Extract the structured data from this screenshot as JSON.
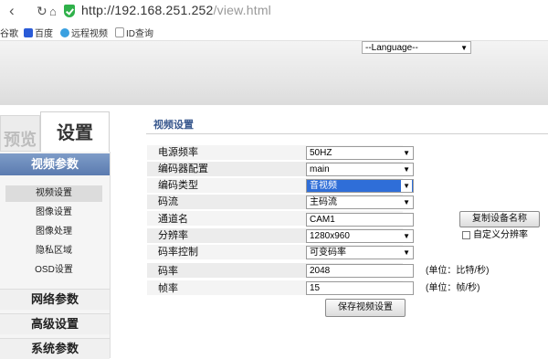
{
  "browser": {
    "url_host": "http://192.168.251.252",
    "url_path": "/view.html",
    "bookmarks": [
      "谷歌",
      "百度",
      "远程视频",
      "ID查询"
    ]
  },
  "header": {
    "language_select": "--Language--"
  },
  "left_tabs": {
    "preview": "预览",
    "settings": "设置"
  },
  "sidebar": {
    "active_category": "视频参数",
    "subitems": [
      "视频设置",
      "图像设置",
      "图像处理",
      "隐私区域",
      "OSD设置"
    ],
    "categories": [
      "网络参数",
      "高级设置",
      "系统参数"
    ]
  },
  "main": {
    "section_title": "视频设置",
    "fields": {
      "power_freq": {
        "label": "电源频率",
        "value": "50HZ"
      },
      "encoder_config": {
        "label": "编码器配置",
        "value": "main"
      },
      "encoding_type": {
        "label": "编码类型",
        "value": "音视频"
      },
      "stream": {
        "label": "码流",
        "value": "主码流"
      },
      "channel_name": {
        "label": "通道名",
        "value": "CAM1"
      },
      "resolution": {
        "label": "分辨率",
        "value": "1280x960"
      },
      "bitrate_control": {
        "label": "码率控制",
        "value": "可变码率"
      },
      "bitrate": {
        "label": "码率",
        "value": "2048",
        "unit": "(单位：比特/秒)"
      },
      "framerate": {
        "label": "帧率",
        "value": "15",
        "unit": "(单位：帧/秒)"
      }
    },
    "copy_device_name_button": "复制设备名称",
    "custom_resolution_label": "自定义分辨率",
    "save_button": "保存视频设置"
  }
}
